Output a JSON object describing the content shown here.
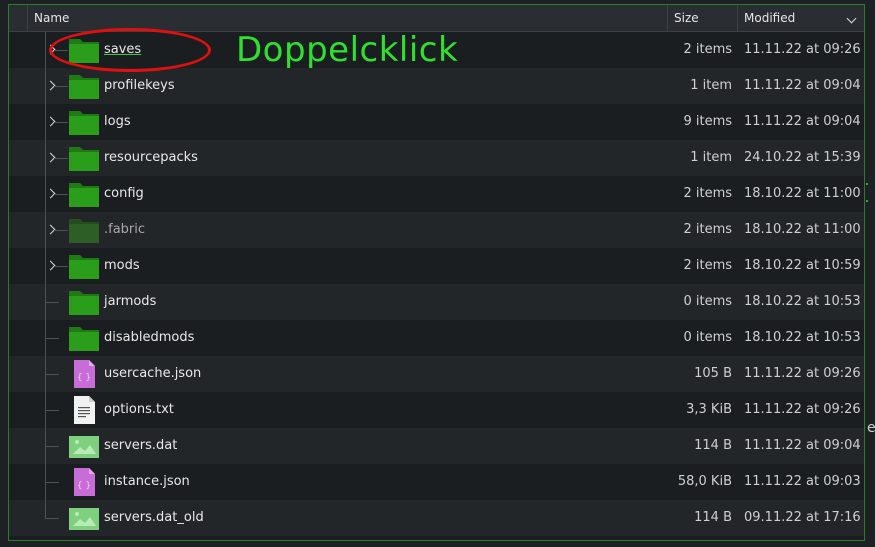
{
  "header": {
    "name": "Name",
    "size": "Size",
    "modified": "Modified"
  },
  "annotation": {
    "label": "Doppelcklick"
  },
  "edge": {
    "glyph": "e"
  },
  "colors": {
    "folder": "#2a9d1a",
    "folder_dim": "#2c5e25",
    "annotation_ring": "#e01010",
    "annotation_text": "#2fe02f"
  },
  "files": [
    {
      "name": "saves",
      "size": "2 items",
      "modified": "11.11.22 at 09:26",
      "icon": "folder-icon",
      "expandable": true
    },
    {
      "name": "profilekeys",
      "size": "1 item",
      "modified": "11.11.22 at 09:04",
      "icon": "folder-icon",
      "expandable": true
    },
    {
      "name": "logs",
      "size": "9 items",
      "modified": "11.11.22 at 09:04",
      "icon": "folder-icon",
      "expandable": true
    },
    {
      "name": "resourcepacks",
      "size": "1 item",
      "modified": "24.10.22 at 15:39",
      "icon": "folder-icon",
      "expandable": true
    },
    {
      "name": "config",
      "size": "2 items",
      "modified": "18.10.22 at 11:00",
      "icon": "folder-icon",
      "expandable": true
    },
    {
      "name": ".fabric",
      "size": "2 items",
      "modified": "18.10.22 at 11:00",
      "icon": "folder-hidden-icon",
      "expandable": true
    },
    {
      "name": "mods",
      "size": "2 items",
      "modified": "18.10.22 at 10:59",
      "icon": "folder-icon",
      "expandable": true
    },
    {
      "name": "jarmods",
      "size": "0 items",
      "modified": "18.10.22 at 10:53",
      "icon": "folder-icon",
      "expandable": false
    },
    {
      "name": "disabledmods",
      "size": "0 items",
      "modified": "18.10.22 at 10:53",
      "icon": "folder-icon",
      "expandable": false
    },
    {
      "name": "usercache.json",
      "size": "105 B",
      "modified": "11.11.22 at 09:26",
      "icon": "json-file-icon",
      "expandable": false
    },
    {
      "name": "options.txt",
      "size": "3,3 KiB",
      "modified": "11.11.22 at 09:26",
      "icon": "text-file-icon",
      "expandable": false
    },
    {
      "name": "servers.dat",
      "size": "114 B",
      "modified": "11.11.22 at 09:04",
      "icon": "image-file-icon",
      "expandable": false
    },
    {
      "name": "instance.json",
      "size": "58,0 KiB",
      "modified": "11.11.22 at 09:03",
      "icon": "json-file-icon",
      "expandable": false
    },
    {
      "name": "servers.dat_old",
      "size": "114 B",
      "modified": "09.11.22 at 17:16",
      "icon": "image-file-icon",
      "expandable": false
    }
  ]
}
